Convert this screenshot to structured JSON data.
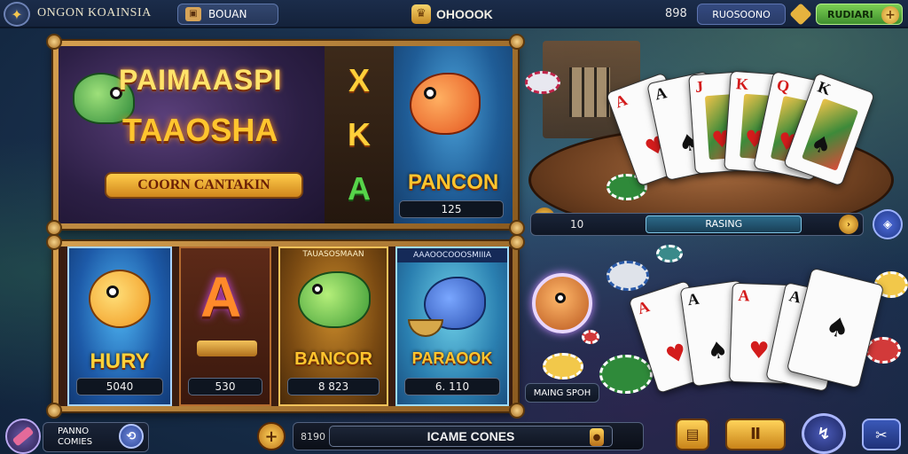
{
  "topbar": {
    "logo_icon": "crest-icon",
    "title": "ONGON KOAINSIA",
    "search_label": "BOUAN",
    "center_label": "OHOOOK",
    "balance": "898",
    "field_label": "RUOSOONO",
    "cta_label": "RUDIARI",
    "cta_plus": "+"
  },
  "promo": {
    "title_line1": "PAIMAASPI",
    "title_line2": "TAAOSHA",
    "button_label": "COORN CANTAKIN",
    "reel_symbols": [
      "X",
      "K",
      "A"
    ],
    "featured": {
      "name": "PANCON",
      "value": "125"
    }
  },
  "tiles": [
    {
      "header": "",
      "name": "HURY",
      "value": "5040"
    },
    {
      "header": "",
      "name": "",
      "value": "530"
    },
    {
      "header": "TAUASOSMAAN",
      "name": "BANCOR",
      "value": "8  823"
    },
    {
      "header": "AAAOOCOOOSMIIIA",
      "name": "PARAOOK",
      "value": "6.  110"
    }
  ],
  "table": {
    "bet_left": "10",
    "bet_label": "RASING",
    "top_hand": [
      {
        "rank": "A",
        "suit": "♥",
        "color": "red"
      },
      {
        "rank": "A",
        "suit": "♠",
        "color": "black"
      },
      {
        "rank": "J",
        "suit": "♥",
        "color": "red"
      },
      {
        "rank": "K",
        "suit": "♥",
        "color": "red"
      },
      {
        "rank": "Q",
        "suit": "♥",
        "color": "red"
      },
      {
        "rank": "K",
        "suit": "♠",
        "color": "black"
      }
    ],
    "bottom_hand": [
      {
        "rank": "A",
        "suit": "♥",
        "color": "red"
      },
      {
        "rank": "A",
        "suit": "♠",
        "color": "black"
      },
      {
        "rank": "A",
        "suit": "♥",
        "color": "red"
      },
      {
        "rank": "A",
        "suit": "♠",
        "color": "black"
      }
    ],
    "avatar_label": "MAING SPOH"
  },
  "bottom": {
    "profile_line1": "PANNO",
    "profile_line2": "COMIES",
    "add_label": "+",
    "bet_value": "8190",
    "main_label": "ICAME CONES",
    "coin_icon": "coin-icon",
    "menu_icons": [
      "paytable-icon",
      "pause-icon",
      "spin-icon",
      "settings-icon"
    ]
  },
  "colors": {
    "gold": "#d6a050",
    "accent_green": "#5ab83e",
    "bg_navy": "#14223b"
  }
}
